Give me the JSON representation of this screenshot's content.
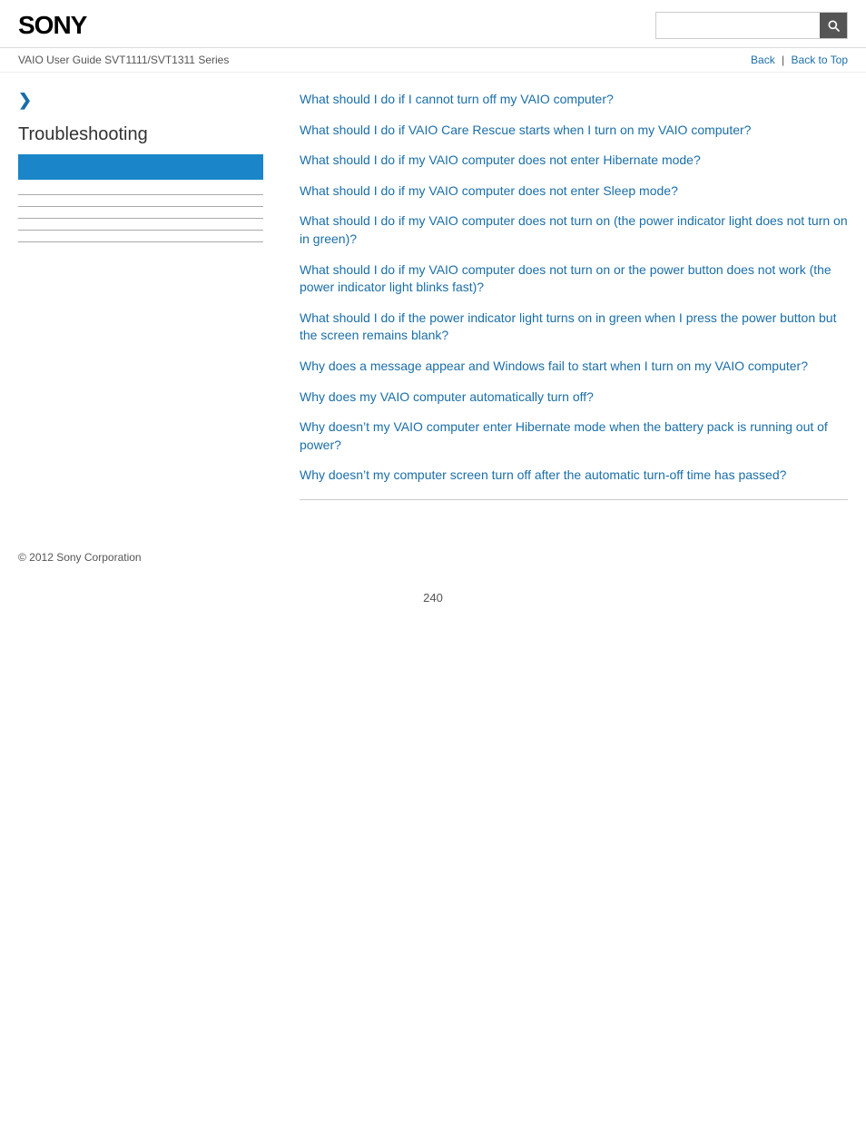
{
  "header": {
    "logo": "SONY",
    "search_placeholder": ""
  },
  "nav": {
    "guide_title": "VAIO User Guide SVT1111/SVT1311 Series",
    "back_label": "Back",
    "back_to_top_label": "Back to Top"
  },
  "sidebar": {
    "expand_icon": "❯",
    "section_title": "Troubleshooting",
    "dividers": 5
  },
  "content": {
    "links": [
      "What should I do if I cannot turn off my VAIO computer?",
      "What should I do if VAIO Care Rescue starts when I turn on my VAIO computer?",
      "What should I do if my VAIO computer does not enter Hibernate mode?",
      "What should I do if my VAIO computer does not enter Sleep mode?",
      "What should I do if my VAIO computer does not turn on (the power indicator light does not turn on in green)?",
      "What should I do if my VAIO computer does not turn on or the power button does not work (the power indicator light blinks fast)?",
      "What should I do if the power indicator light turns on in green when I press the power button but the screen remains blank?",
      "Why does a message appear and Windows fail to start when I turn on my VAIO computer?",
      "Why does my VAIO computer automatically turn off?",
      "Why doesn’t my VAIO computer enter Hibernate mode when the battery pack is running out of power?",
      "Why doesn’t my computer screen turn off after the automatic turn-off time has passed?"
    ]
  },
  "footer": {
    "copyright": "© 2012 Sony Corporation"
  },
  "page_number": "240",
  "colors": {
    "link": "#1a6ea8",
    "sidebar_highlight": "#1a85c8"
  }
}
